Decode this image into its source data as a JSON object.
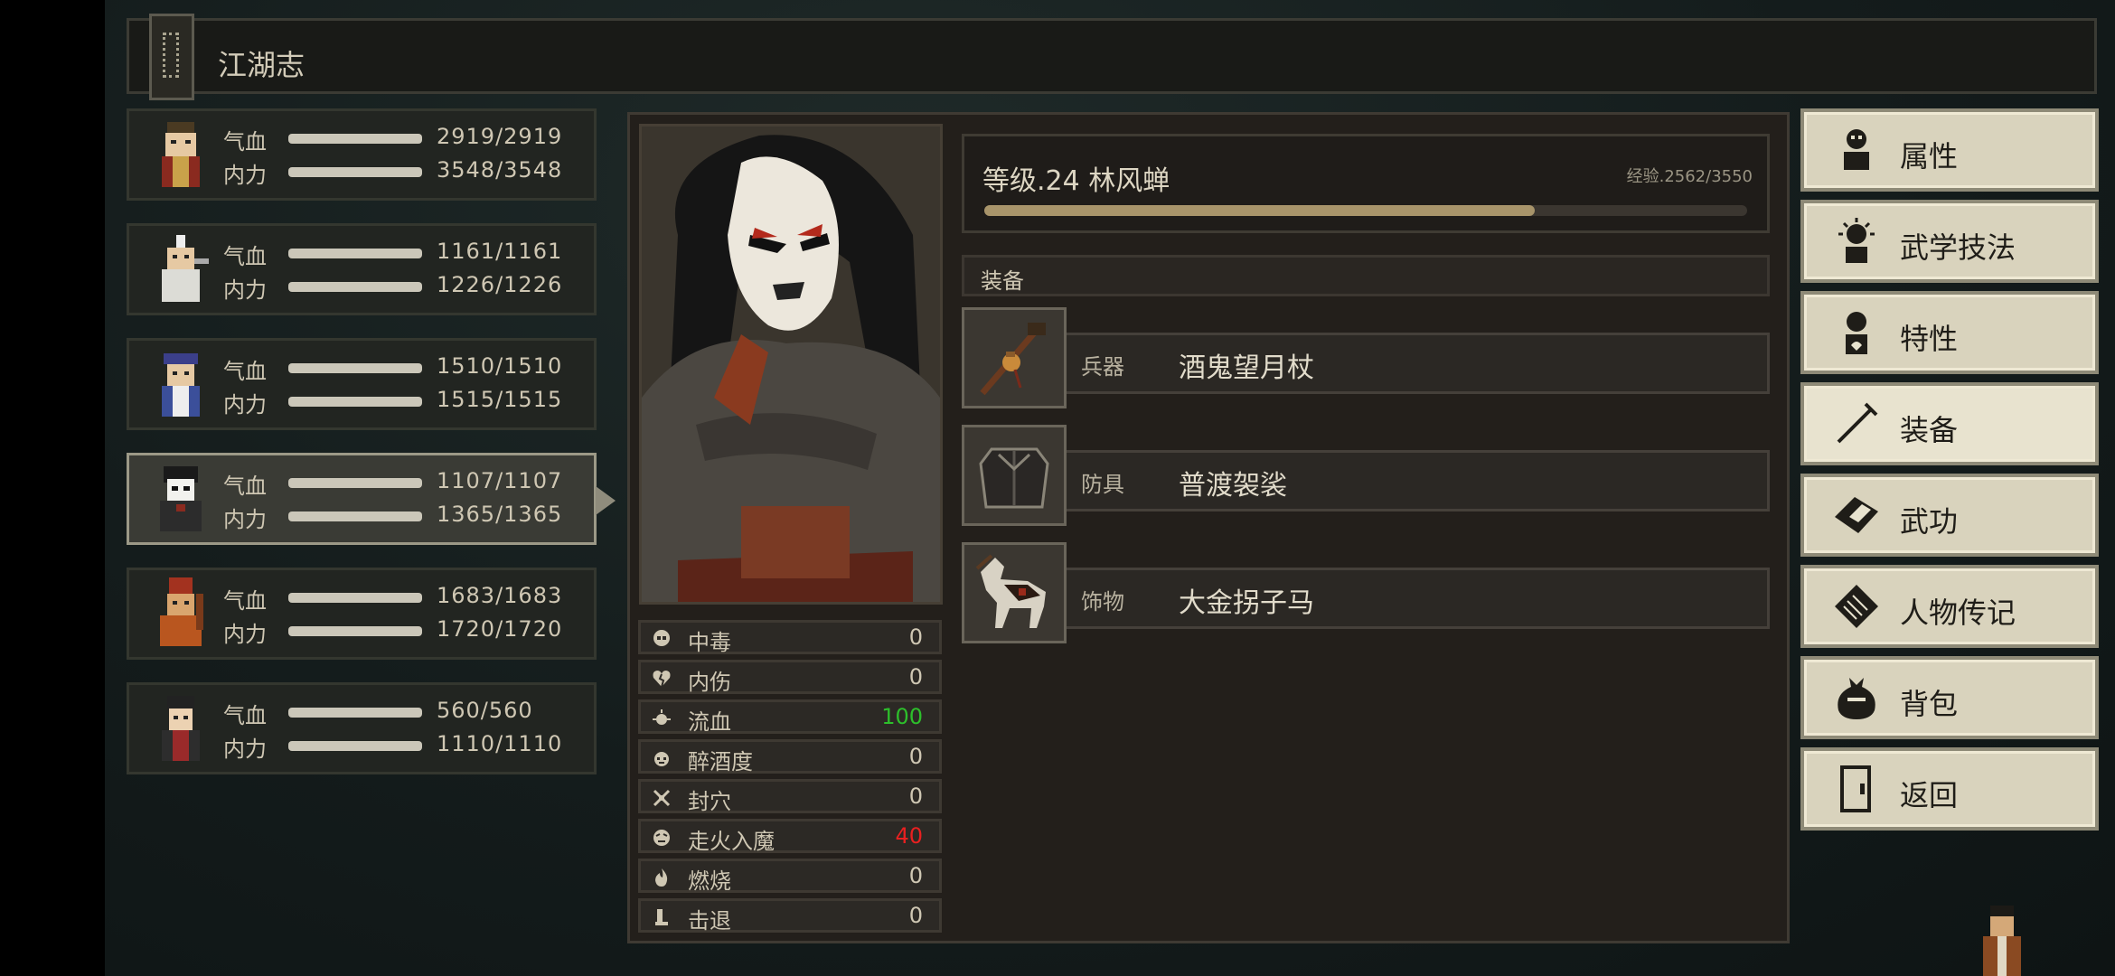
{
  "header": {
    "title": "江湖志"
  },
  "party": [
    {
      "hp_label": "气血",
      "hp": "2919/2919",
      "mp_label": "内力",
      "mp": "3548/3548"
    },
    {
      "hp_label": "气血",
      "hp": "1161/1161",
      "mp_label": "内力",
      "mp": "1226/1226"
    },
    {
      "hp_label": "气血",
      "hp": "1510/1510",
      "mp_label": "内力",
      "mp": "1515/1515"
    },
    {
      "hp_label": "气血",
      "hp": "1107/1107",
      "mp_label": "内力",
      "mp": "1365/1365"
    },
    {
      "hp_label": "气血",
      "hp": "1683/1683",
      "mp_label": "内力",
      "mp": "1720/1720"
    },
    {
      "hp_label": "气血",
      "hp": "560/560",
      "mp_label": "内力",
      "mp": "1110/1110"
    }
  ],
  "selected_party_index": 3,
  "character": {
    "level_text": "等级.24  林风蝉",
    "exp_text": "经验.2562/3550",
    "exp_fraction": 0.7217
  },
  "status": [
    {
      "name": "中毒",
      "value": "0",
      "color": "#cfc7b3"
    },
    {
      "name": "内伤",
      "value": "0",
      "color": "#cfc7b3"
    },
    {
      "name": "流血",
      "value": "100",
      "color": "#2dbf2b"
    },
    {
      "name": "醉酒度",
      "value": "0",
      "color": "#cfc7b3"
    },
    {
      "name": "封穴",
      "value": "0",
      "color": "#cfc7b3"
    },
    {
      "name": "走火入魔",
      "value": "40",
      "color": "#e82020"
    },
    {
      "name": "燃烧",
      "value": "0",
      "color": "#cfc7b3"
    },
    {
      "name": "击退",
      "value": "0",
      "color": "#cfc7b3"
    }
  ],
  "equipment": {
    "header": "装备",
    "slots": [
      {
        "category": "兵器",
        "item": "酒鬼望月杖",
        "icon": "staff-icon"
      },
      {
        "category": "防具",
        "item": "普渡袈裟",
        "icon": "robe-icon"
      },
      {
        "category": "饰物",
        "item": "大金拐子马",
        "icon": "horse-icon"
      }
    ]
  },
  "menu": [
    {
      "label": "属性",
      "icon": "person-icon"
    },
    {
      "label": "武学技法",
      "icon": "martial-skill-icon"
    },
    {
      "label": "特性",
      "icon": "trait-icon"
    },
    {
      "label": "装备",
      "icon": "sword-icon",
      "active": true
    },
    {
      "label": "武功",
      "icon": "manual-icon"
    },
    {
      "label": "人物传记",
      "icon": "biography-icon"
    },
    {
      "label": "背包",
      "icon": "bag-icon"
    },
    {
      "label": "返回",
      "icon": "door-icon"
    }
  ],
  "colors": {
    "exp_bar": "#a8946a",
    "bleed": "#2dbf2b",
    "qi_deviation": "#e82020",
    "menu_bg": "#d9d3bd"
  }
}
